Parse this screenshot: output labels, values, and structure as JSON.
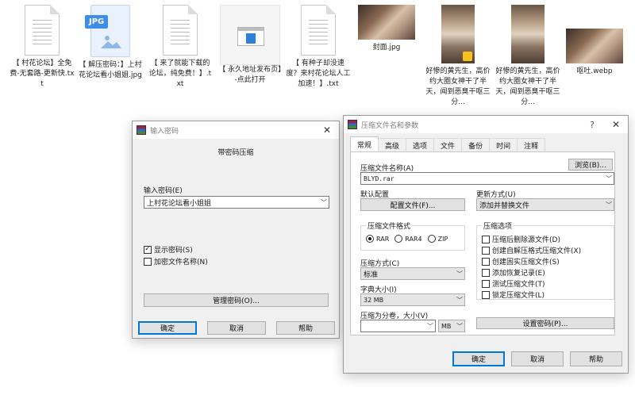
{
  "desktop": {
    "files": [
      {
        "label": "【 村花论坛】全免费-无套路-更新快.txt",
        "kind": "txt"
      },
      {
        "label": "【 解压密码：】上村花论坛看小姐姐.jpg",
        "kind": "jpg",
        "badge": "JPG"
      },
      {
        "label": "【 来了就能下载的论坛，纯免费！】.txt",
        "kind": "txt"
      },
      {
        "label": "【 永久地址发布页】-点此打开",
        "kind": "html"
      },
      {
        "label": "【 有种子却没速度？来村花论坛人工加速！】.txt",
        "kind": "txt"
      },
      {
        "label": "封面.jpg",
        "kind": "photo-wide"
      },
      {
        "label": "好惨的黄先生，高价约大圈女神干了半天，闻到恶臭干呕三分...",
        "kind": "photo-tall"
      },
      {
        "label": "好惨的黄先生，高价约大圈女神干了半天，闻到恶臭干呕三分...",
        "kind": "photo-tall"
      },
      {
        "label": "呕吐.webp",
        "kind": "photo-wide"
      }
    ]
  },
  "password_dialog": {
    "title": "输入密码",
    "heading": "带密码压缩",
    "input_label": "输入密码(E)",
    "password_value": "上村花论坛看小姐姐",
    "show_password_label": "显示密码(S)",
    "show_password_checked": true,
    "encrypt_names_label": "加密文件名称(N)",
    "encrypt_names_checked": false,
    "manage_button": "管理密码(O)...",
    "ok_button": "确定",
    "cancel_button": "取消",
    "help_button": "帮助"
  },
  "archive_dialog": {
    "title": "压缩文件名和参数",
    "help_glyph": "?",
    "tabs": [
      "常规",
      "高级",
      "选项",
      "文件",
      "备份",
      "时间",
      "注释"
    ],
    "active_tab": 0,
    "archive_name_label": "压缩文件名称(A)",
    "browse_button": "浏览(B)...",
    "archive_name_value": "BLYD.rar",
    "default_profile_label": "默认配置",
    "profiles_button": "配置文件(F)...",
    "update_mode_label": "更新方式(U)",
    "update_mode_value": "添加并替换文件",
    "format_group_label": "压缩文件格式",
    "formats": [
      {
        "label": "RAR",
        "selected": true
      },
      {
        "label": "RAR4",
        "selected": false
      },
      {
        "label": "ZIP",
        "selected": false
      }
    ],
    "method_label": "压缩方式(C)",
    "method_value": "标准",
    "dict_label": "字典大小(I)",
    "dict_value": "32 MB",
    "split_label": "压缩为分卷，大小(V)",
    "split_value": "",
    "split_unit": "MB",
    "options_group_label": "压缩选项",
    "options": [
      {
        "label": "压缩后删除源文件(D)",
        "checked": false
      },
      {
        "label": "创建自解压格式压缩文件(X)",
        "checked": false
      },
      {
        "label": "创建固实压缩文件(S)",
        "checked": false
      },
      {
        "label": "添加恢复记录(E)",
        "checked": false
      },
      {
        "label": "测试压缩文件(T)",
        "checked": false
      },
      {
        "label": "锁定压缩文件(L)",
        "checked": false
      }
    ],
    "set_password_button": "设置密码(P)...",
    "ok_button": "确定",
    "cancel_button": "取消",
    "help_button": "帮助"
  }
}
